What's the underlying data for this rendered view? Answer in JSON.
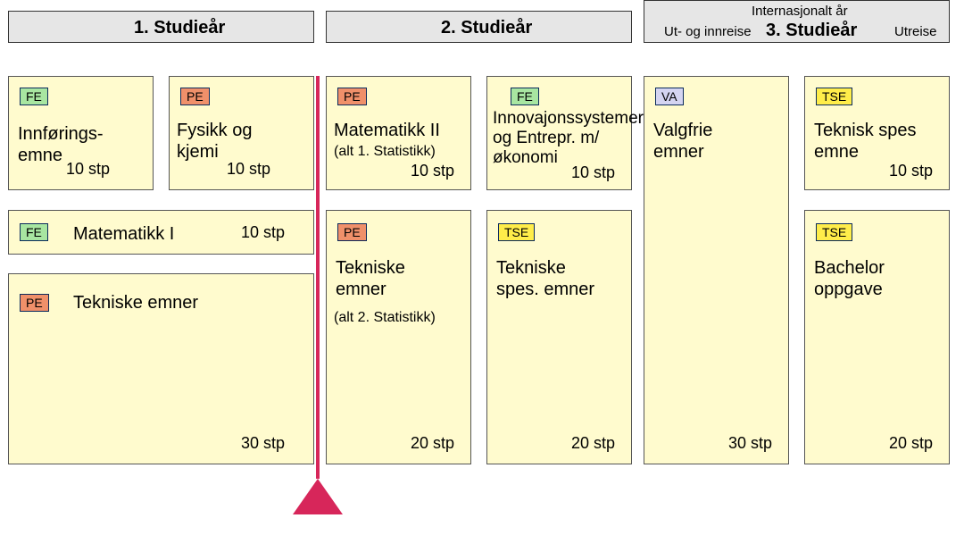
{
  "headers": {
    "y1": {
      "label": "1. Studieår"
    },
    "y2": {
      "label": "2. Studieår"
    },
    "y3": {
      "top": "Internasjonalt år",
      "label": "3. Studieår",
      "left_sub": "Ut- og innreise",
      "right_sub": "Utreise"
    }
  },
  "tags": {
    "FE": "FE",
    "PE": "PE",
    "TSE": "TSE",
    "VA": "VA"
  },
  "courses": {
    "y1a": {
      "tag": "FE",
      "title": "Innførings-\nemne",
      "credits": "10 stp"
    },
    "y1b": {
      "tag": "PE",
      "title": "Fysikk og\nkjemi",
      "credits": "10 stp"
    },
    "y1c": {
      "tag": "FE",
      "title": "Matematikk I",
      "credits": "10 stp"
    },
    "y1d": {
      "tag": "PE",
      "title": "Tekniske emner",
      "credits": "30 stp"
    },
    "y2a": {
      "tag": "PE",
      "title": "Matematikk II",
      "subtitle": "(alt 1. Statistikk)",
      "credits": "10 stp"
    },
    "y2b": {
      "tag": "FE",
      "title": "Innovajonssystemer\nog Entrepr. m/\nøkonomi",
      "credits": "10 stp"
    },
    "y2c": {
      "tag": "PE",
      "title": "Tekniske\n emner",
      "subtitle": "(alt 2. Statistikk)",
      "credits": "20 stp"
    },
    "y2d": {
      "tag": "TSE",
      "title": "Tekniske\nspes. emner",
      "credits": "20 stp"
    },
    "y3a": {
      "tag": "VA",
      "title": "Valgfrie\nemner",
      "credits": "30 stp"
    },
    "y3b": {
      "tag": "TSE",
      "title": "Teknisk spes\nemne",
      "credits": "10 stp"
    },
    "y3c": {
      "tag": "TSE",
      "title": "Bachelor\noppgave",
      "credits": "20 stp"
    }
  }
}
